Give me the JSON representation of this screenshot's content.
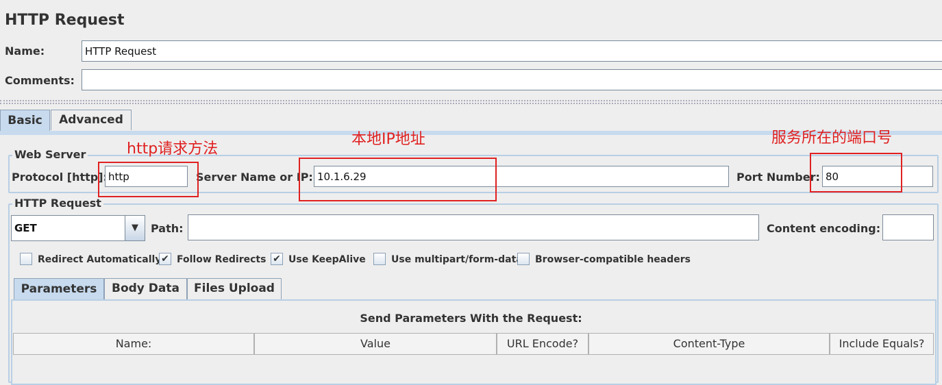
{
  "title": "HTTP Request",
  "name_label": "Name:",
  "name_value": "HTTP Request",
  "comments_label": "Comments:",
  "comments_value": "",
  "tabs": [
    "Basic",
    "Advanced"
  ],
  "web_server": {
    "legend": "Web Server",
    "protocol_label": "Protocol [http]:",
    "protocol_value": "http",
    "server_label": "Server Name or IP:",
    "server_value": "10.1.6.29",
    "port_label": "Port Number:",
    "port_value": "80"
  },
  "http_request": {
    "legend": "HTTP Request",
    "method": "GET",
    "path_label": "Path:",
    "path_value": "",
    "encoding_label": "Content encoding:",
    "encoding_value": "",
    "checkboxes": [
      {
        "label": "Redirect Automatically",
        "checked": false
      },
      {
        "label": "Follow Redirects",
        "checked": true
      },
      {
        "label": "Use KeepAlive",
        "checked": true
      },
      {
        "label": "Use multipart/form-data",
        "checked": false
      },
      {
        "label": "Browser-compatible headers",
        "checked": false
      }
    ]
  },
  "sub_tabs": [
    "Parameters",
    "Body Data",
    "Files Upload"
  ],
  "params": {
    "title": "Send Parameters With the Request:",
    "columns": [
      "Name:",
      "Value",
      "URL Encode?",
      "Content-Type",
      "Include Equals?"
    ]
  },
  "annotations": {
    "protocol": "http请求方法",
    "server": "本地IP地址",
    "port": "服务所在的端口号"
  },
  "check_mark": "✔"
}
